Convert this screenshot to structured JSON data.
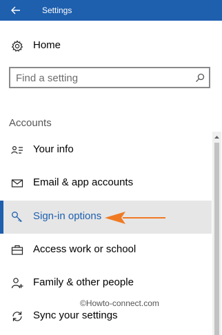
{
  "titlebar": {
    "title": "Settings",
    "back_icon": "arrow-left-icon"
  },
  "home": {
    "label": "Home",
    "icon": "gear-icon"
  },
  "search": {
    "placeholder": "Find a setting",
    "value": "",
    "icon": "search-icon"
  },
  "section": {
    "header": "Accounts"
  },
  "nav": {
    "items": [
      {
        "label": "Your info",
        "icon": "person-card-icon"
      },
      {
        "label": "Email & app accounts",
        "icon": "envelope-icon"
      },
      {
        "label": "Sign-in options",
        "icon": "key-icon",
        "selected": true
      },
      {
        "label": "Access work or school",
        "icon": "briefcase-icon"
      },
      {
        "label": "Family & other people",
        "icon": "person-add-icon"
      },
      {
        "label": "Sync your settings",
        "icon": "sync-icon"
      }
    ]
  },
  "annotation": {
    "watermark": "©Howto-connect.com",
    "arrow_color": "#f07a22"
  },
  "colors": {
    "accent": "#1e5fae",
    "selected_bg": "#e6e6e6"
  }
}
